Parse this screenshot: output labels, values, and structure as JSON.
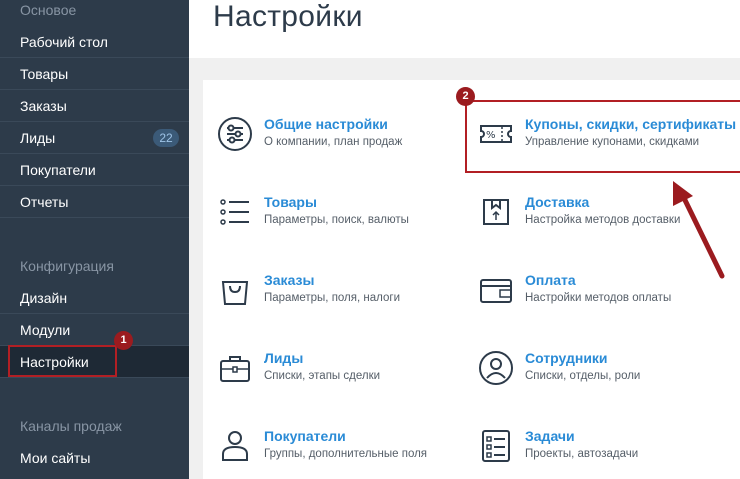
{
  "sidebar": {
    "section_main": "Основое",
    "items_main": [
      {
        "label": "Рабочий стол"
      },
      {
        "label": "Товары"
      },
      {
        "label": "Заказы"
      },
      {
        "label": "Лиды",
        "badge": "22"
      },
      {
        "label": "Покупатели"
      },
      {
        "label": "Отчеты"
      }
    ],
    "section_config": "Конфигурация",
    "items_config": [
      {
        "label": "Дизайн"
      },
      {
        "label": "Модули"
      },
      {
        "label": "Настройки"
      }
    ],
    "section_channels": "Каналы продаж",
    "items_channels": [
      {
        "label": "Мои сайты"
      }
    ]
  },
  "page": {
    "title": "Настройки"
  },
  "settings": [
    {
      "title": "Общие настройки",
      "subtitle": "О компании, план продаж",
      "icon": "sliders-icon"
    },
    {
      "title": "Купоны, скидки, сертификаты",
      "subtitle": "Управление купонами, скидками",
      "icon": "coupon-icon"
    },
    {
      "title": "Товары",
      "subtitle": "Параметры, поиск, валюты",
      "icon": "list-icon"
    },
    {
      "title": "Доставка",
      "subtitle": "Настройка методов доставки",
      "icon": "box-icon"
    },
    {
      "title": "Заказы",
      "subtitle": "Параметры, поля, налоги",
      "icon": "bag-icon"
    },
    {
      "title": "Оплата",
      "subtitle": "Настройки методов оплаты",
      "icon": "wallet-icon"
    },
    {
      "title": "Лиды",
      "subtitle": "Списки, этапы сделки",
      "icon": "briefcase-icon"
    },
    {
      "title": "Сотрудники",
      "subtitle": "Списки, отделы, роли",
      "icon": "user-circle-icon"
    },
    {
      "title": "Покупатели",
      "subtitle": "Группы, дополнительные поля",
      "icon": "person-icon"
    },
    {
      "title": "Задачи",
      "subtitle": "Проекты, автозадачи",
      "icon": "checklist-icon"
    }
  ],
  "annotations": {
    "marker1": "1",
    "marker2": "2",
    "color": "#b21f24"
  },
  "colors": {
    "sidebar_bg": "#2d3b4a",
    "link": "#2a8bd6",
    "badge_bg": "#3b5a78"
  }
}
